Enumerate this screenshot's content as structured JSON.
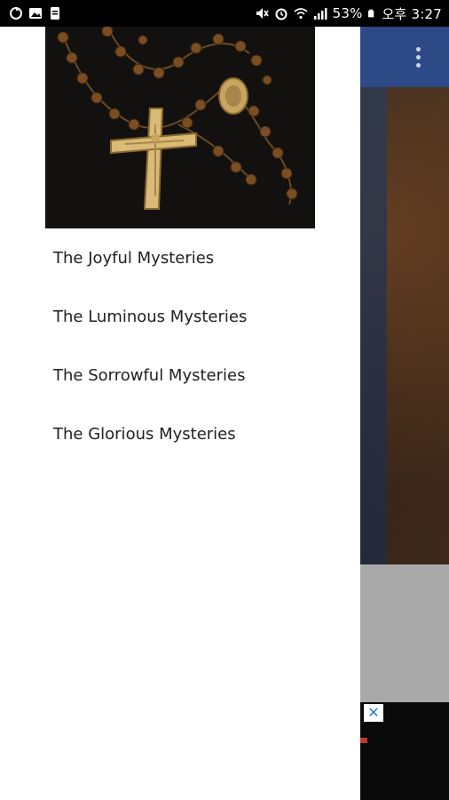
{
  "status_bar": {
    "left_icons": [
      "sync-icon",
      "gallery-icon",
      "clipboard-icon"
    ],
    "right_icons": [
      "mute-icon",
      "alarm-icon",
      "wifi-icon",
      "signal-icon"
    ],
    "battery": "53%",
    "time": "오후 3:27"
  },
  "app": {
    "toolbar_color": "#2d4a86",
    "overflow_icon": "more-vert-icon",
    "ad_close_label": "✕"
  },
  "drawer": {
    "header_image": "rosary-crucifix-image",
    "items": [
      {
        "label": "The Joyful Mysteries"
      },
      {
        "label": "The Luminous Mysteries"
      },
      {
        "label": "The Sorrowful Mysteries"
      },
      {
        "label": "The Glorious Mysteries"
      }
    ]
  }
}
